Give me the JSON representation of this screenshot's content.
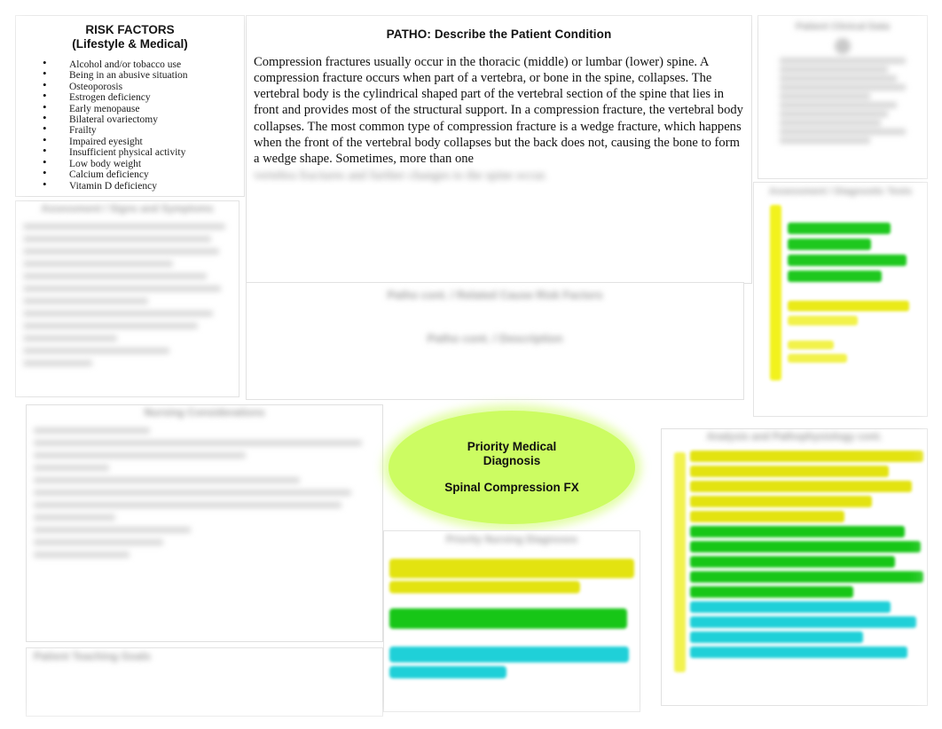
{
  "risk_factors": {
    "title_line1": "RISK FACTORS",
    "title_line2": "(Lifestyle & Medical)",
    "items": [
      "Alcohol and/or tobacco use",
      "Being in an abusive situation",
      "Osteoporosis",
      "Estrogen deficiency",
      "Early menopause",
      "Bilateral ovariectomy",
      "Frailty",
      "Impaired eyesight",
      "Insufficient physical activity",
      "Low body weight",
      "Calcium deficiency",
      "Vitamin D deficiency"
    ]
  },
  "patho": {
    "title": "PATHO:  Describe the Patient Condition",
    "body": "Compression fractures usually occur in the thoracic (middle) or lumbar (lower) spine. A compression fracture occurs when part of a vertebra, or bone in the spine, collapses. The vertebral body is the cylindrical shaped part of the vertebral section of the spine that lies in front and provides most of the structural support. In a compression fracture, the vertebral body collapses. The most common type of compression fracture is a wedge fracture, which happens when the front of the vertebral body collapses but the back does not, causing the bone to form a wedge shape. Sometimes, more than one",
    "tail": "vertebra fractures and further changes to the spine occur."
  },
  "image_panel": {
    "title": "Patient Clinical Data"
  },
  "left_middle": {
    "title": "Assessment / Signs and Symptoms"
  },
  "patho_cont": {
    "title": "Patho cont. / Related Cause Risk Factors",
    "subtitle": "Patho cont. / Description"
  },
  "right_middle": {
    "title": "Assessment / Diagnostic Tests"
  },
  "bottom_left": {
    "title": "Nursing Considerations"
  },
  "bottom_left_2": {
    "title": "Patient Teaching Goals"
  },
  "diagnosis": {
    "line1": "Priority Medical",
    "line2": "Diagnosis",
    "line3": "Spinal Compression FX",
    "fill_color": "#ccfc62"
  },
  "center_bottom": {
    "title": "Priority Nursing Diagnoses"
  },
  "bottom_right": {
    "title": "Analysis and Pathophysiology cont."
  },
  "highlight_colors": {
    "yellow": "#e3e310",
    "yellow_light": "#f2f24f",
    "green": "#17c617",
    "cyan": "#1fd0d8"
  }
}
